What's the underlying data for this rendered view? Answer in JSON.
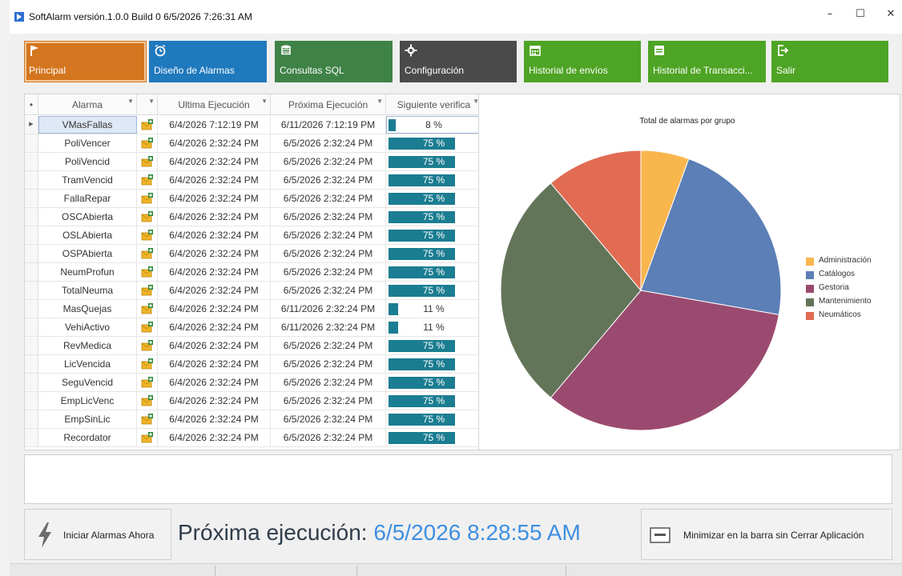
{
  "window": {
    "title": "SoftAlarm  versión.1.0.0 Build 0 6/5/2026 7:26:31 AM",
    "controls": {
      "minimize": "–",
      "maximize": "☐",
      "close": "✕"
    }
  },
  "toolbar": {
    "buttons": [
      {
        "label": "Principal",
        "icon": "flag-icon",
        "color": "#d4761f",
        "active": true
      },
      {
        "label": "Diseño de Alarmas",
        "icon": "alarm-clock-icon",
        "color": "#1f79bd",
        "active": false
      },
      {
        "label": "Consultas SQL",
        "icon": "database-icon",
        "color": "#3f8246",
        "active": false
      },
      {
        "label": "Configuración",
        "icon": "gear-icon",
        "color": "#4a4a4a",
        "active": false
      },
      {
        "label": "Historial de envíos",
        "icon": "calendar-icon",
        "color": "#4ea424",
        "active": false
      },
      {
        "label": "Historial de Transacci...",
        "icon": "ledger-icon",
        "color": "#4ea424",
        "active": false
      },
      {
        "label": "Salir",
        "icon": "exit-icon",
        "color": "#4ea424",
        "active": false
      }
    ]
  },
  "grid": {
    "columns": [
      "Alarma",
      "",
      "Ultima Ejecución",
      "Próxima Ejecución",
      "Siguiente verifica"
    ],
    "rows": [
      {
        "alarma": "VMasFallas",
        "ultima": "6/4/2026 7:12:19 PM",
        "proxima": "6/11/2026 7:12:19 PM",
        "progress_text": "8 %",
        "progress": 0.08,
        "selected": true
      },
      {
        "alarma": "PoliVencer",
        "ultima": "6/4/2026 2:32:24 PM",
        "proxima": "6/5/2026 2:32:24 PM",
        "progress_text": "75 %",
        "progress": 0.75
      },
      {
        "alarma": "PoliVencid",
        "ultima": "6/4/2026 2:32:24 PM",
        "proxima": "6/5/2026 2:32:24 PM",
        "progress_text": "75 %",
        "progress": 0.75
      },
      {
        "alarma": "TramVencid",
        "ultima": "6/4/2026 2:32:24 PM",
        "proxima": "6/5/2026 2:32:24 PM",
        "progress_text": "75 %",
        "progress": 0.75
      },
      {
        "alarma": "FallaRepar",
        "ultima": "6/4/2026 2:32:24 PM",
        "proxima": "6/5/2026 2:32:24 PM",
        "progress_text": "75 %",
        "progress": 0.75
      },
      {
        "alarma": "OSCAbierta",
        "ultima": "6/4/2026 2:32:24 PM",
        "proxima": "6/5/2026 2:32:24 PM",
        "progress_text": "75 %",
        "progress": 0.75
      },
      {
        "alarma": "OSLAbierta",
        "ultima": "6/4/2026 2:32:24 PM",
        "proxima": "6/5/2026 2:32:24 PM",
        "progress_text": "75 %",
        "progress": 0.75
      },
      {
        "alarma": "OSPAbierta",
        "ultima": "6/4/2026 2:32:24 PM",
        "proxima": "6/5/2026 2:32:24 PM",
        "progress_text": "75 %",
        "progress": 0.75
      },
      {
        "alarma": "NeumProfun",
        "ultima": "6/4/2026 2:32:24 PM",
        "proxima": "6/5/2026 2:32:24 PM",
        "progress_text": "75 %",
        "progress": 0.75
      },
      {
        "alarma": "TotalNeuma",
        "ultima": "6/4/2026 2:32:24 PM",
        "proxima": "6/5/2026 2:32:24 PM",
        "progress_text": "75 %",
        "progress": 0.75
      },
      {
        "alarma": "MasQuejas",
        "ultima": "6/4/2026 2:32:24 PM",
        "proxima": "6/11/2026 2:32:24 PM",
        "progress_text": "11 %",
        "progress": 0.11
      },
      {
        "alarma": "VehiActivo",
        "ultima": "6/4/2026 2:32:24 PM",
        "proxima": "6/11/2026 2:32:24 PM",
        "progress_text": "11 %",
        "progress": 0.11
      },
      {
        "alarma": "RevMedica",
        "ultima": "6/4/2026 2:32:24 PM",
        "proxima": "6/5/2026 2:32:24 PM",
        "progress_text": "75 %",
        "progress": 0.75
      },
      {
        "alarma": "LicVencida",
        "ultima": "6/4/2026 2:32:24 PM",
        "proxima": "6/5/2026 2:32:24 PM",
        "progress_text": "75 %",
        "progress": 0.75
      },
      {
        "alarma": "SeguVencid",
        "ultima": "6/4/2026 2:32:24 PM",
        "proxima": "6/5/2026 2:32:24 PM",
        "progress_text": "75 %",
        "progress": 0.75
      },
      {
        "alarma": "EmpLicVenc",
        "ultima": "6/4/2026 2:32:24 PM",
        "proxima": "6/5/2026 2:32:24 PM",
        "progress_text": "75 %",
        "progress": 0.75
      },
      {
        "alarma": "EmpSinLic",
        "ultima": "6/4/2026 2:32:24 PM",
        "proxima": "6/5/2026 2:32:24 PM",
        "progress_text": "75 %",
        "progress": 0.75
      },
      {
        "alarma": "Recordator",
        "ultima": "6/4/2026 2:32:24 PM",
        "proxima": "6/5/2026 2:32:24 PM",
        "progress_text": "75 %",
        "progress": 0.75
      }
    ],
    "progress_color": "#1b7d91"
  },
  "chart_data": {
    "type": "pie",
    "title": "Total de alarmas por grupo",
    "categories": [
      "Administración",
      "Catálogos",
      "Gestoria",
      "Mantenimiento",
      "Neumáticos"
    ],
    "values": [
      1,
      4,
      6,
      5,
      2
    ],
    "colors": [
      "#f9b64d",
      "#5b7fb6",
      "#9b4a6f",
      "#637559",
      "#e16c53"
    ],
    "legend_position": "right"
  },
  "bottom": {
    "start_button_label": "Iniciar Alarmas Ahora",
    "next_run_label": "Próxima ejecución:",
    "next_run_value": "6/5/2026 8:28:55 AM",
    "minimize_button_label": "Minimizar en la barra sin Cerrar Aplicación"
  }
}
